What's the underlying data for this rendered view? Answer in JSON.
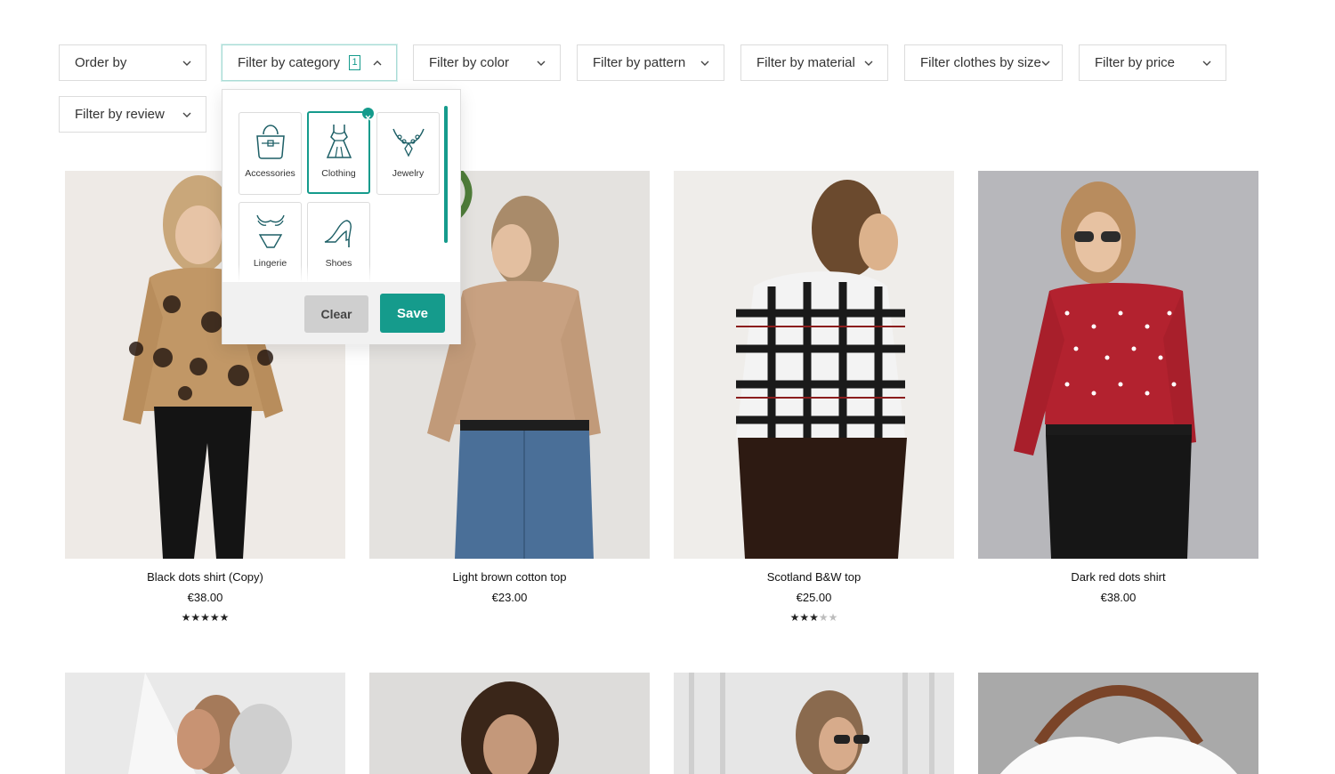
{
  "filters": {
    "order_by": "Order by",
    "category": "Filter by category",
    "category_count": "1",
    "color": "Filter by color",
    "pattern": "Filter by pattern",
    "material": "Filter by material",
    "size": "Filter clothes by size",
    "price": "Filter by price",
    "review": "Filter by review"
  },
  "category_dropdown": {
    "items": [
      {
        "label": "Accessories",
        "icon": "handbag-icon",
        "selected": false
      },
      {
        "label": "Clothing",
        "icon": "dress-icon",
        "selected": true
      },
      {
        "label": "Jewelry",
        "icon": "necklace-icon",
        "selected": false
      },
      {
        "label": "Lingerie",
        "icon": "lingerie-icon",
        "selected": false
      },
      {
        "label": "Shoes",
        "icon": "high-heel-icon",
        "selected": false
      }
    ],
    "clear_label": "Clear",
    "save_label": "Save"
  },
  "products": [
    {
      "name": "Black dots shirt (Copy)",
      "price": "€38.00",
      "rating": 5
    },
    {
      "name": "Light brown cotton top",
      "price": "€23.00",
      "rating": null
    },
    {
      "name": "Scotland B&W top",
      "price": "€25.00",
      "rating": 3
    },
    {
      "name": "Dark red dots shirt",
      "price": "€38.00",
      "rating": null
    }
  ],
  "colors": {
    "accent": "#159b8c",
    "border": "#dcdcdc"
  }
}
